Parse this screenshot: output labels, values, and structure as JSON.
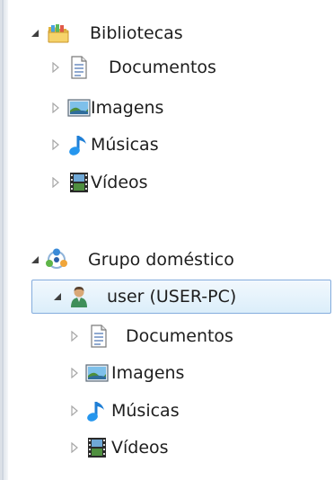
{
  "tree": {
    "libraries": {
      "label": "Bibliotecas",
      "icon": "libraries-folder-icon",
      "children": [
        {
          "label": "Documentos",
          "icon": "documents-icon"
        },
        {
          "label": "Imagens",
          "icon": "pictures-icon"
        },
        {
          "label": "Músicas",
          "icon": "music-icon"
        },
        {
          "label": "Vídeos",
          "icon": "videos-icon"
        }
      ]
    },
    "homegroup": {
      "label": "Grupo doméstico",
      "icon": "homegroup-icon",
      "user": {
        "label": "user (USER-PC)",
        "icon": "user-icon",
        "children": [
          {
            "label": "Documentos",
            "icon": "documents-icon"
          },
          {
            "label": "Imagens",
            "icon": "pictures-icon"
          },
          {
            "label": "Músicas",
            "icon": "music-icon"
          },
          {
            "label": "Vídeos",
            "icon": "videos-icon"
          }
        ]
      }
    }
  },
  "colors": {
    "selection_border": "#84acdd",
    "selection_fill": "#dbeefa",
    "expander": "#a7a7a7",
    "expanded": "#404040"
  }
}
